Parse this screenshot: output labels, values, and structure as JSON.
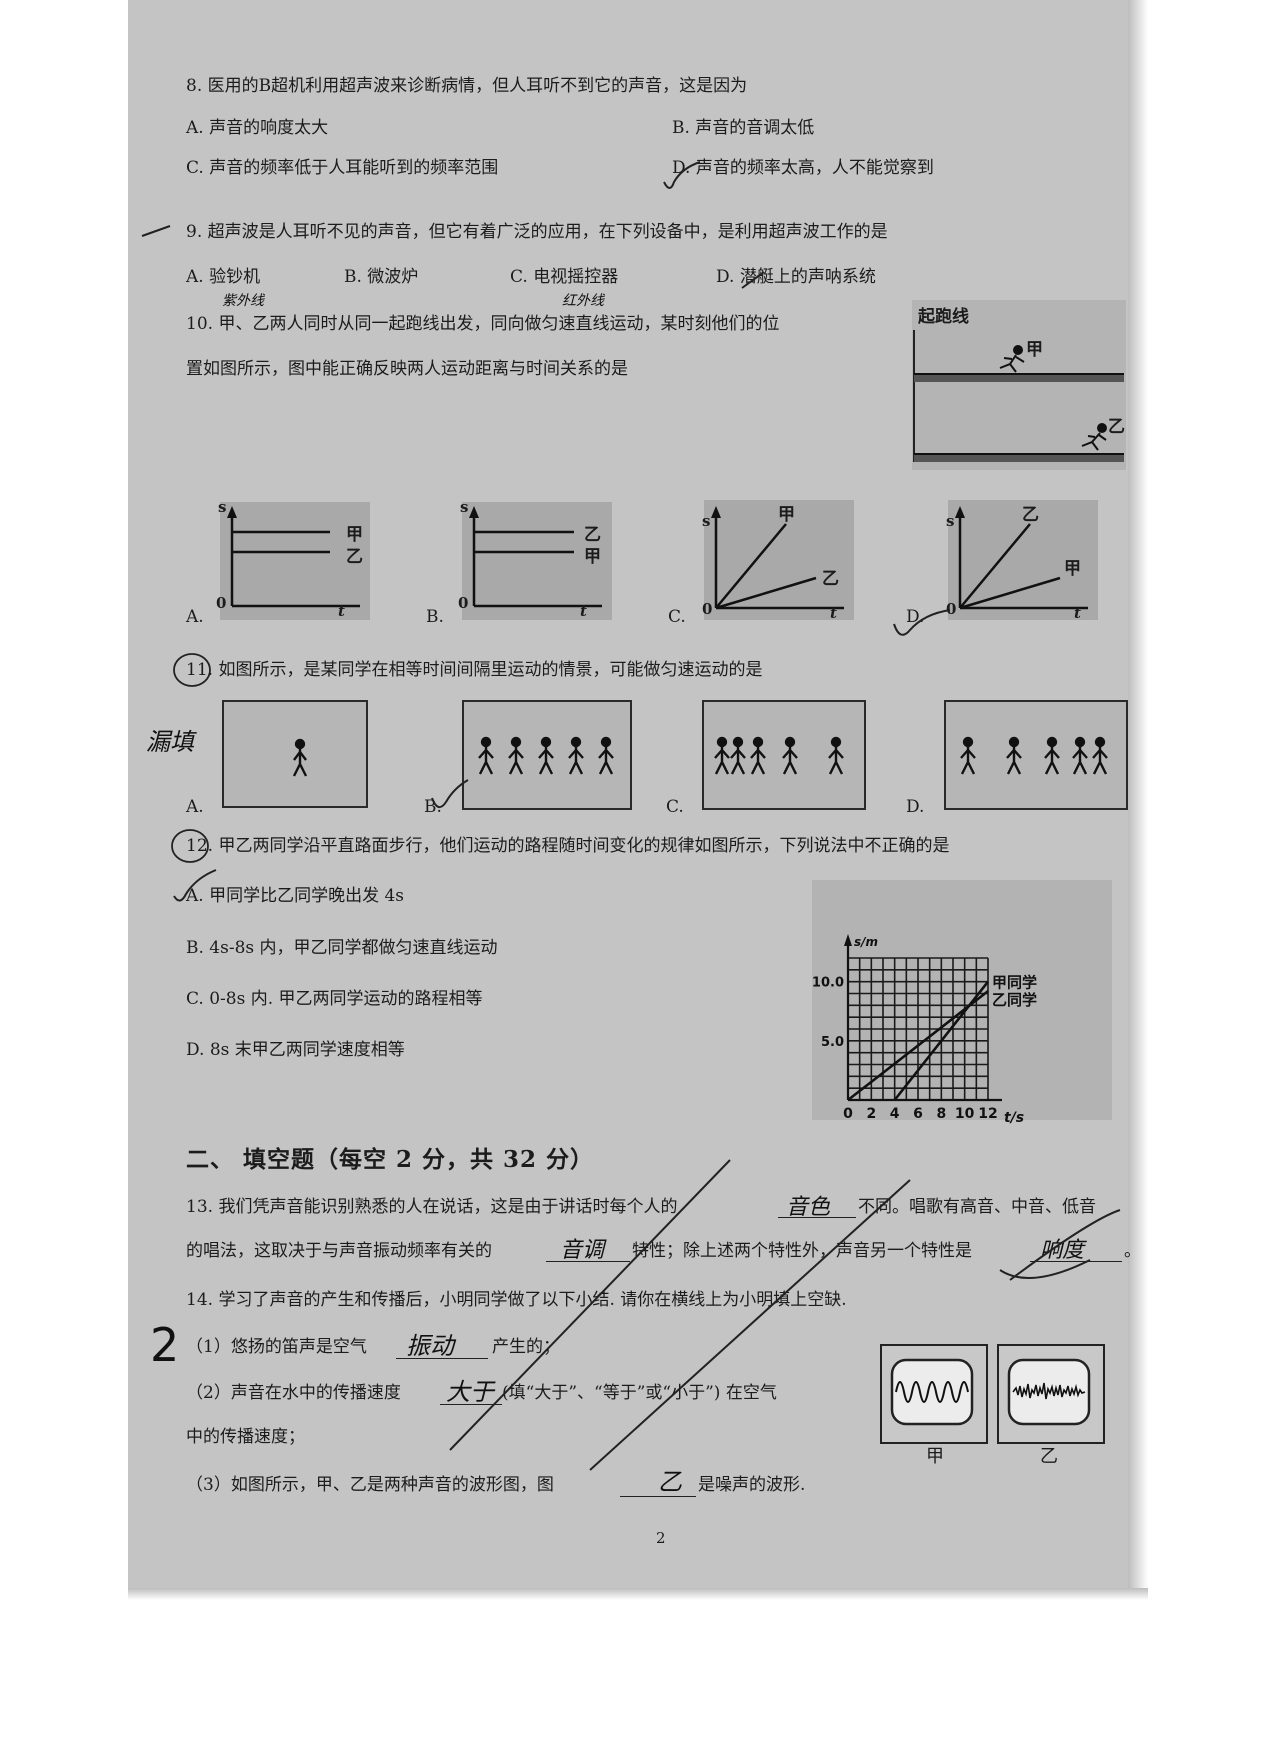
{
  "questions": {
    "q8": {
      "stem": "8. 医用的B超机利用超声波来诊断病情，但人耳听不到它的声音，这是因为",
      "options": [
        "A. 声音的响度太大",
        "B. 声音的音调太低",
        "C. 声音的频率低于人耳能听到的频率范围",
        "D. 声音的频率太高，人不能觉察到"
      ]
    },
    "q9": {
      "stem": "9. 超声波是人耳听不见的声音，但它有着广泛的应用，在下列设备中，是利用超声波工作的是",
      "options": [
        "A. 验钞机",
        "B. 微波炉",
        "C. 电视摇控器",
        "D. 潜艇上的声呐系统"
      ],
      "notes": [
        "紫外线",
        "红外线"
      ]
    },
    "q10": {
      "stem_line1": "10. 甲、乙两人同时从同一起跑线出发，同向做匀速直线运动，某时刻他们的位",
      "stem_line2": "置如图所示，图中能正确反映两人运动距离与时间关系的是",
      "figure_title": "起跑线",
      "runner_a": "甲",
      "runner_b": "乙",
      "options": [
        "A.",
        "B.",
        "C.",
        "D."
      ],
      "graph_labels": {
        "s": "s",
        "t": "t",
        "zero": "0",
        "a": [
          "甲",
          "乙"
        ],
        "b": [
          "乙",
          "甲"
        ],
        "c": [
          "甲",
          "乙"
        ],
        "d": [
          "乙",
          "甲"
        ]
      }
    },
    "q11": {
      "stem": "11. 如图所示，是某同学在相等时间间隔里运动的情景，可能做匀速运动的是",
      "options": [
        "A.",
        "B.",
        "C.",
        "D."
      ],
      "note": "漏填"
    },
    "q12": {
      "stem": "12. 甲乙两同学沿平直路面步行，他们运动的路程随时间变化的规律如图所示，下列说法中不正确的是",
      "options": [
        "A. 甲同学比乙同学晚出发 4s",
        "B. 4s-8s 内，甲乙同学都做匀速直线运动",
        "C. 0-8s 内. 甲乙两同学运动的路程相等",
        "D. 8s 末甲乙两同学速度相等"
      ]
    },
    "q13": {
      "line1": "13. 我们凭声音能识别熟悉的人在说话，这是由于讲话时每个人的",
      "line1_end": "不同。唱歌有高音、中音、低音",
      "line2_start": "的唱法，这取决于与声音振动频率有关的",
      "line2_mid": "特性；除上述两个特性外，声音另一个特性是",
      "line2_end": "。",
      "answers": [
        "音色",
        "音调",
        "响度"
      ]
    },
    "q14": {
      "stem": "14. 学习了声音的产生和传播后，小明同学做了以下小结. 请你在横线上为小明填上空缺.",
      "p1_start": "（1）悠扬的笛声是空气",
      "p1_end": "产生的；",
      "p2_start": "（2）声音在水中的传播速度",
      "p2_end": "(填“大于”、“等于”或“小于”) 在空气",
      "p2_line2": "中的传播速度；",
      "p3_start": "（3）如图所示，甲、乙是两种声音的波形图，图",
      "p3_end": "是噪声的波形.",
      "answers": [
        "振动",
        "大于",
        "乙"
      ],
      "wave_labels": [
        "甲",
        "乙"
      ],
      "score_mark": "2"
    }
  },
  "section2": {
    "title": "二、  填空题（每空 2 分，共 32 分）"
  },
  "footer": {
    "page_number": "2"
  },
  "chart_data": {
    "type": "line",
    "xlabel": "t/s",
    "ylabel": "s/m",
    "x_ticks": [
      "0",
      "2",
      "4",
      "6",
      "8",
      "10",
      "12"
    ],
    "y_ticks": [
      "5.0",
      "10.0"
    ],
    "xlim": [
      0,
      12
    ],
    "ylim": [
      0,
      12
    ],
    "grid": true,
    "series": [
      {
        "name": "甲同学",
        "x": [
          4,
          12
        ],
        "y": [
          0,
          10
        ]
      },
      {
        "name": "乙同学",
        "x": [
          0,
          12
        ],
        "y": [
          0,
          9.2
        ]
      }
    ]
  }
}
